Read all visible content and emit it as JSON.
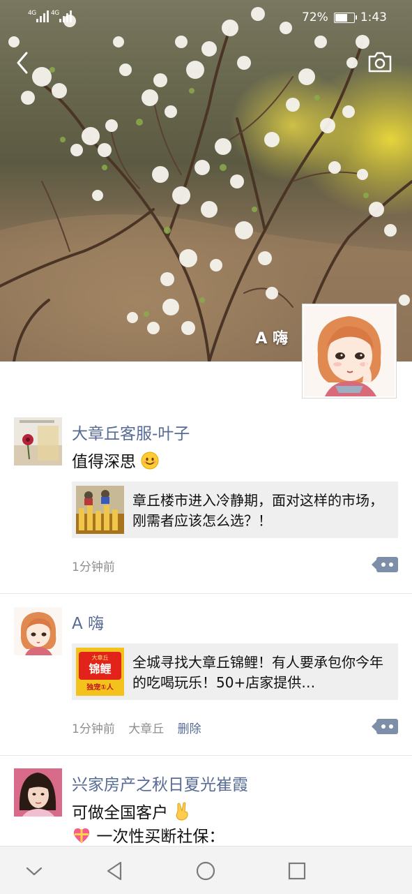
{
  "status_bar": {
    "signal_1": "4G",
    "signal_2": "4G",
    "battery_text": "72%",
    "battery_level": 0.72,
    "time": "1:43"
  },
  "header": {
    "back_icon": "chevron-left-icon",
    "camera_icon": "camera-icon",
    "profile_name": "A 嗨"
  },
  "posts": [
    {
      "name": "大章丘客服-叶子",
      "text": "值得深思",
      "emoji": "smile-emoji",
      "link_title": "章丘楼市进入冷静期，面对这样的市场，刚需者应该怎么选？！",
      "time": "1分钟前"
    },
    {
      "name": "A 嗨",
      "link_title": "全城寻找大章丘锦鲤！有人要承包你今年的吃喝玩乐！50+店家提供…",
      "thumb_top": "大章丘",
      "thumb_main": "锦鲤",
      "thumb_bottom": "独宠①人",
      "time": "1分钟前",
      "location": "大章丘",
      "delete_label": "删除"
    },
    {
      "name": "兴家房产之秋日夏光崔霞",
      "text_line1": "可做全国客户",
      "text_line2": "一次性买断社保："
    }
  ],
  "nav": {
    "collapse_icon": "chevron-down-icon",
    "back_icon": "triangle-back-icon",
    "home_icon": "circle-home-icon",
    "recents_icon": "square-recents-icon"
  },
  "colors": {
    "name_blue": "#576b95",
    "comment_button": "#7d8ea9",
    "link_card_bg": "#efefef"
  }
}
